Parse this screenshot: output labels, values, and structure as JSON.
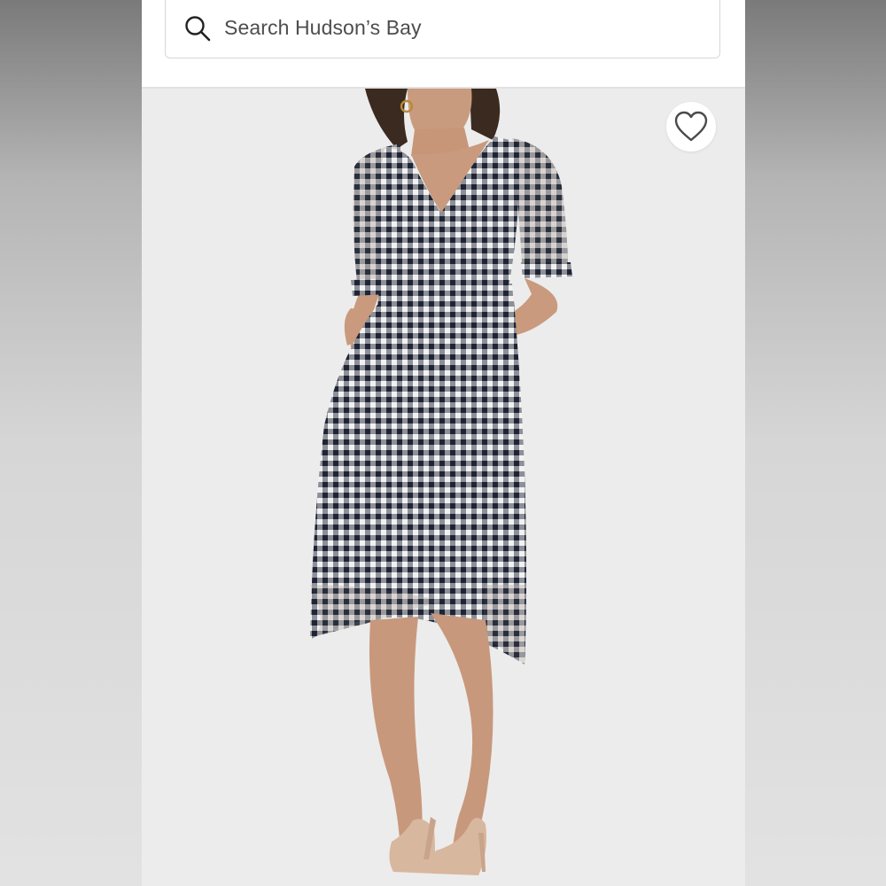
{
  "search": {
    "placeholder": "Search Hudson’s Bay"
  },
  "icons": {
    "search": "search-icon",
    "favorite": "heart-icon"
  },
  "colors": {
    "background": "#ebebeb",
    "header": "#ffffff",
    "placeholder_text": "#4d4d4d",
    "heart_outline": "#4a4a4a"
  }
}
